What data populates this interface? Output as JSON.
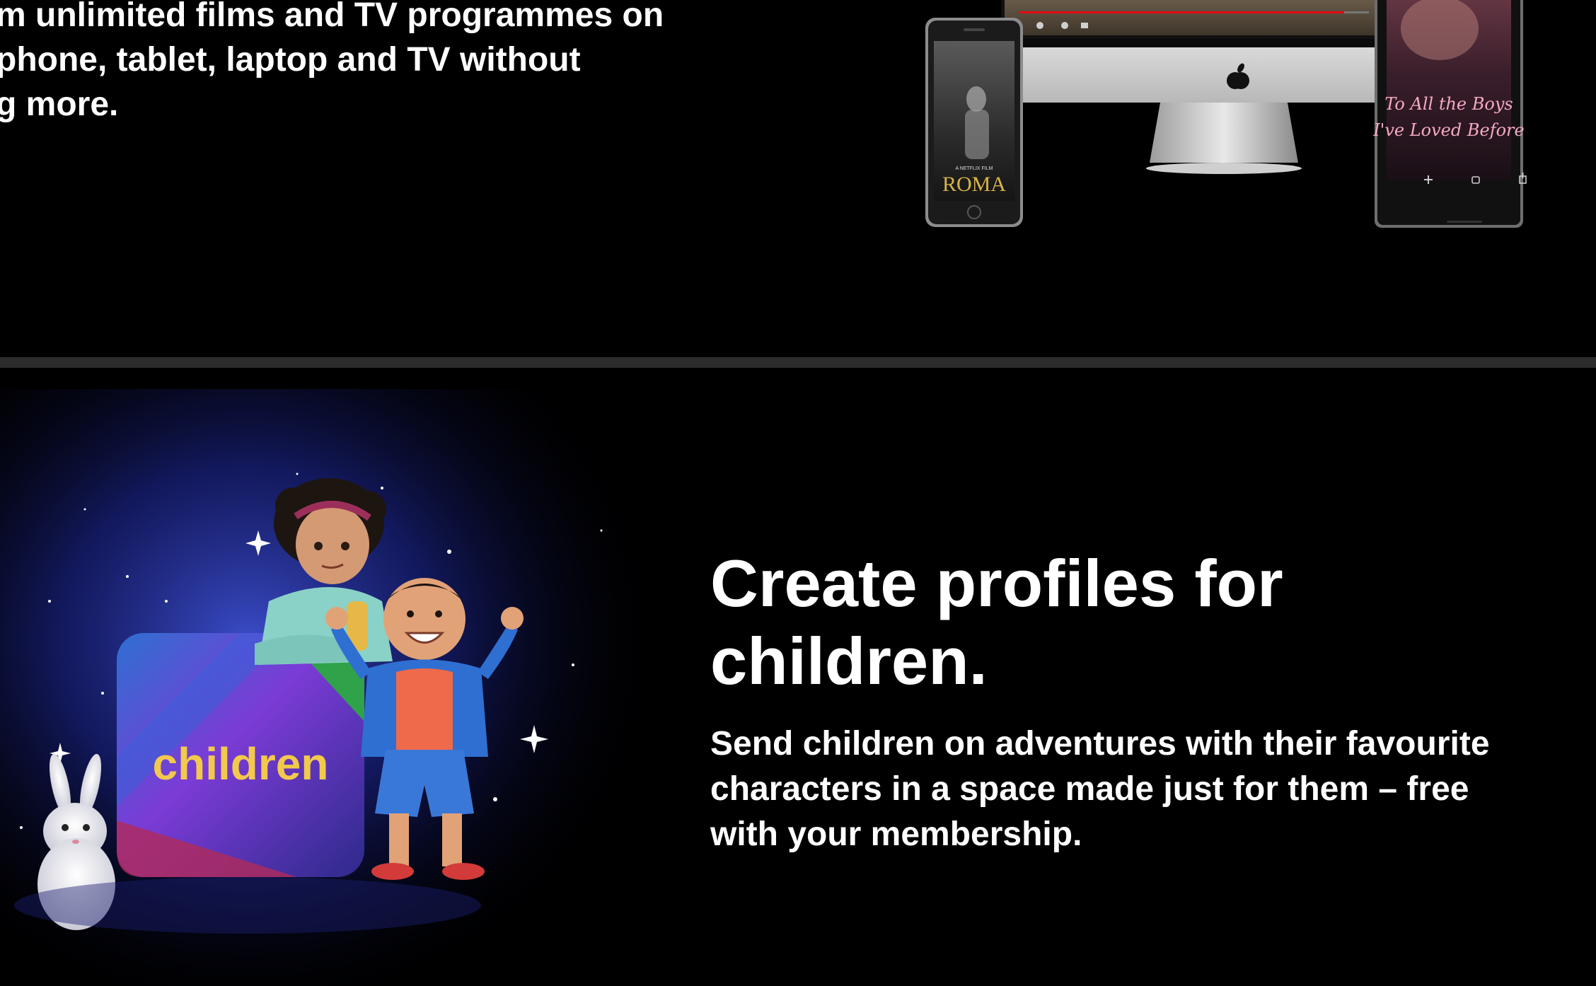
{
  "devices_section": {
    "description": "m unlimited films and TV programmes on\nphone, tablet, laptop and TV without\ng more.",
    "phone_title": "ROMA",
    "phone_caption": "A NETFLIX FILM",
    "tablet_title_line1": "To All the Boys",
    "tablet_title_line2": "I've Loved Before"
  },
  "children_section": {
    "heading": "Create profiles for children.",
    "description": "Send children on adventures with their favourite characters in a space made just for them – free with your membership.",
    "logo_text": "children"
  },
  "colors": {
    "background": "#000000",
    "divider": "#2c2c2c",
    "text": "#ffffff",
    "children_logo": "#f2c94c",
    "accent_red": "#e50914"
  }
}
